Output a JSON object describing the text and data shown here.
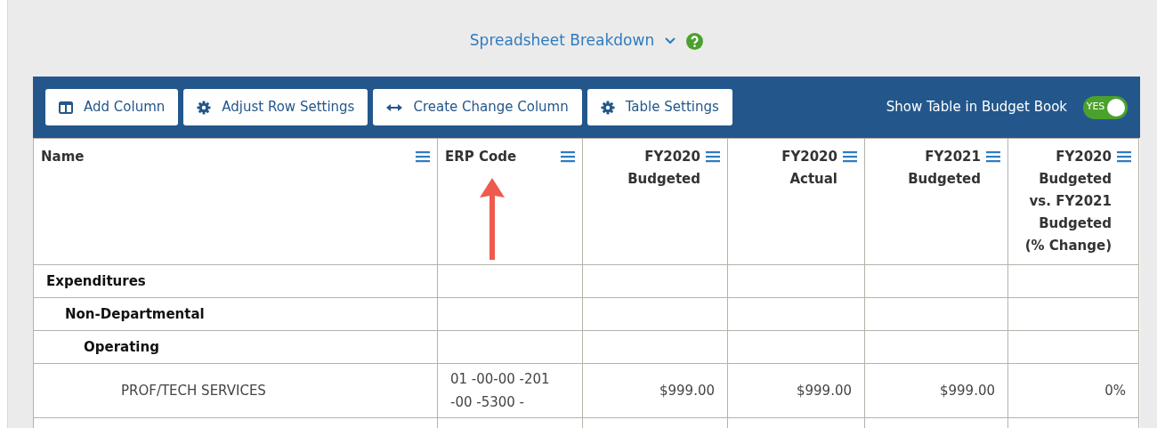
{
  "title": {
    "label": "Spreadsheet Breakdown"
  },
  "toolbar": {
    "buttons": [
      {
        "label": "Add Column",
        "kind": "columns"
      },
      {
        "label": "Adjust Row Settings",
        "kind": "gear"
      },
      {
        "label": "Create Change Column",
        "kind": "arrows"
      },
      {
        "label": "Table Settings",
        "kind": "gear"
      }
    ],
    "toggle": {
      "label": "Show Table in Budget Book",
      "on": true,
      "text": "YES"
    }
  },
  "table": {
    "columns": [
      {
        "heading": "Name"
      },
      {
        "heading": "ERP Code"
      },
      {
        "heading": "FY2020 Budgeted"
      },
      {
        "heading": "FY2020 Actual"
      },
      {
        "heading": "FY2021 Budgeted"
      },
      {
        "heading": "FY2020 Budgeted vs. FY2021 Budgeted (% Change)"
      }
    ],
    "rows": [
      {
        "name": "Expenditures",
        "children": [
          {
            "name": "Non-Departmental",
            "children": [
              {
                "name": "Operating",
                "children": [
                  {
                    "name": "PROF/TECH SERVICES",
                    "cells": [
                      "01 -00-00 -201 -00 -5300 -",
                      "$999.00",
                      "$999.00",
                      "$999.00",
                      "0%"
                    ]
                  }
                ]
              }
            ]
          }
        ]
      }
    ]
  }
}
